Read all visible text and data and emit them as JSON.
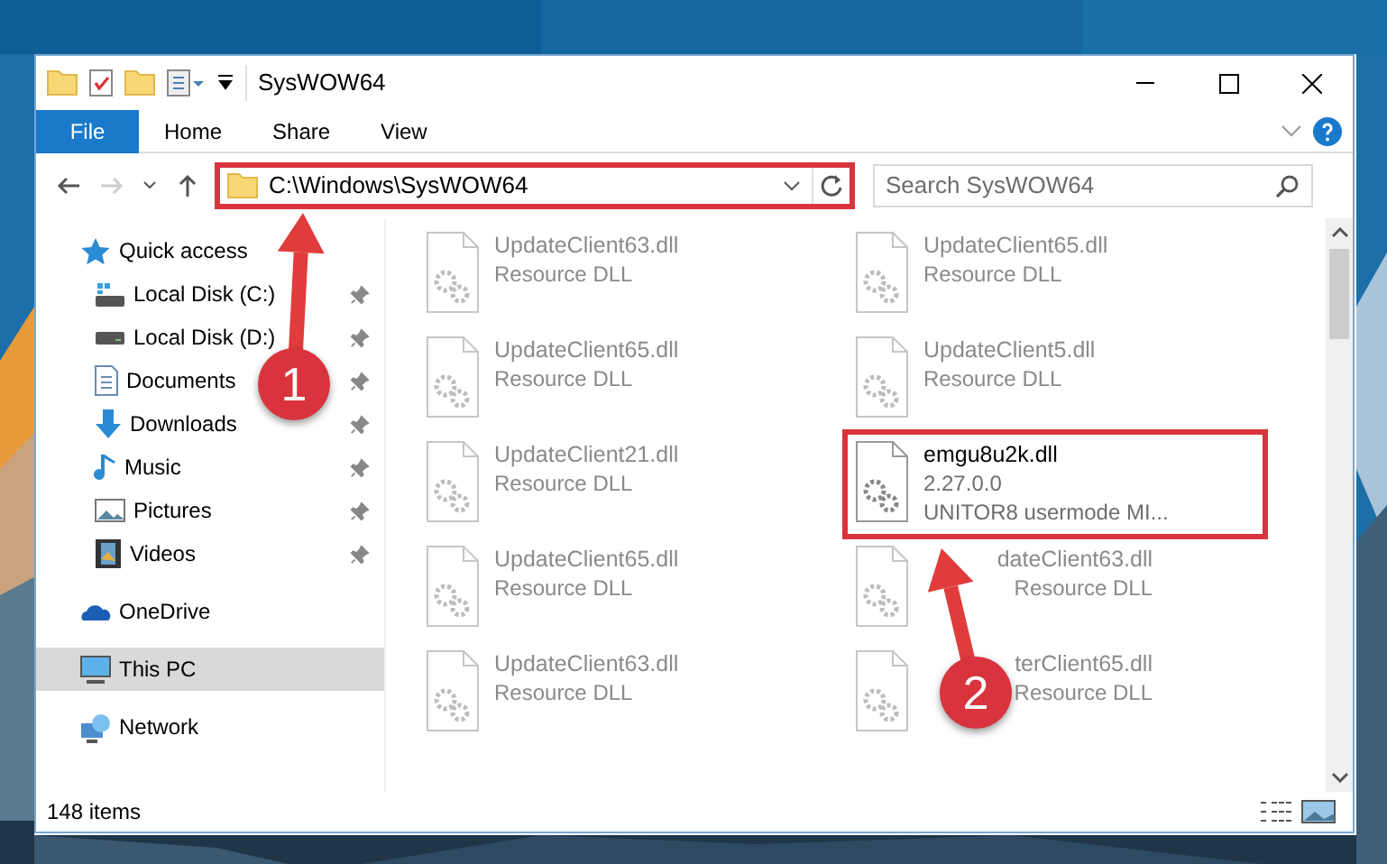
{
  "window": {
    "title": "SysWOW64"
  },
  "ribbon_tabs": [
    {
      "label": "File",
      "kind": "file"
    },
    {
      "label": "Home",
      "kind": "tab"
    },
    {
      "label": "Share",
      "kind": "tab"
    },
    {
      "label": "View",
      "kind": "tab"
    }
  ],
  "address": {
    "path": "C:\\Windows\\SysWOW64",
    "highlighted": true
  },
  "search": {
    "placeholder": "Search SysWOW64"
  },
  "sidebar": {
    "items": [
      {
        "label": "Quick access",
        "kind": "quick-access",
        "selected": false,
        "children": [
          {
            "label": "Local Disk (C:)",
            "kind": "drive-c",
            "pinned": true,
            "selected": false
          },
          {
            "label": "Local Disk (D:)",
            "kind": "drive",
            "pinned": true,
            "selected": false
          },
          {
            "label": "Documents",
            "kind": "documents",
            "pinned": true,
            "selected": false
          },
          {
            "label": "Downloads",
            "kind": "downloads",
            "pinned": true,
            "selected": false
          },
          {
            "label": "Music",
            "kind": "music",
            "pinned": true,
            "selected": false
          },
          {
            "label": "Pictures",
            "kind": "pictures",
            "pinned": true,
            "selected": false
          },
          {
            "label": "Videos",
            "kind": "videos",
            "pinned": true,
            "selected": false
          }
        ]
      },
      {
        "label": "OneDrive",
        "kind": "onedrive",
        "selected": false
      },
      {
        "label": "This PC",
        "kind": "pc",
        "selected": true
      },
      {
        "label": "Network",
        "kind": "network",
        "selected": false
      }
    ]
  },
  "files": [
    {
      "name": "UpdateClient63.dll",
      "details": [
        "Resource DLL"
      ],
      "kind": "plain",
      "blurred": true,
      "highlighted": false
    },
    {
      "name": "UpdateClient65.dll",
      "details": [
        "Resource DLL"
      ],
      "kind": "plain",
      "blurred": true,
      "highlighted": false
    },
    {
      "name": "UpdateClient65.dll",
      "details": [
        "Resource DLL"
      ],
      "kind": "plain",
      "blurred": true,
      "highlighted": false
    },
    {
      "name": "UpdateClient5.dll",
      "details": [
        "Resource DLL"
      ],
      "kind": "plain",
      "blurred": true,
      "highlighted": false
    },
    {
      "name": "UpdateClient21.dll",
      "details": [
        "Resource DLL"
      ],
      "kind": "plain",
      "blurred": true,
      "highlighted": false
    },
    {
      "name": "emgu8u2k.dll",
      "details": [
        "2.27.0.0",
        "UNITOR8 usermode MI..."
      ],
      "kind": "plain",
      "blurred": false,
      "highlighted": true
    },
    {
      "name": "UpdateClient65.dll",
      "details": [
        "Resource DLL"
      ],
      "kind": "plain",
      "blurred": true,
      "highlighted": false
    },
    {
      "name": "dateClient63.dll",
      "details": [
        "Resource DLL"
      ],
      "kind": "covered",
      "blurred": true,
      "highlighted": false
    },
    {
      "name": "UpdateClient63.dll",
      "details": [
        "Resource DLL"
      ],
      "kind": "plain",
      "blurred": true,
      "highlighted": false
    },
    {
      "name": "terClient65.dll",
      "details": [
        "Resource DLL"
      ],
      "kind": "covered",
      "blurred": true,
      "highlighted": false
    }
  ],
  "annotations": [
    {
      "label": "1"
    },
    {
      "label": "2"
    }
  ],
  "status_bar": {
    "text": "148 items"
  }
}
